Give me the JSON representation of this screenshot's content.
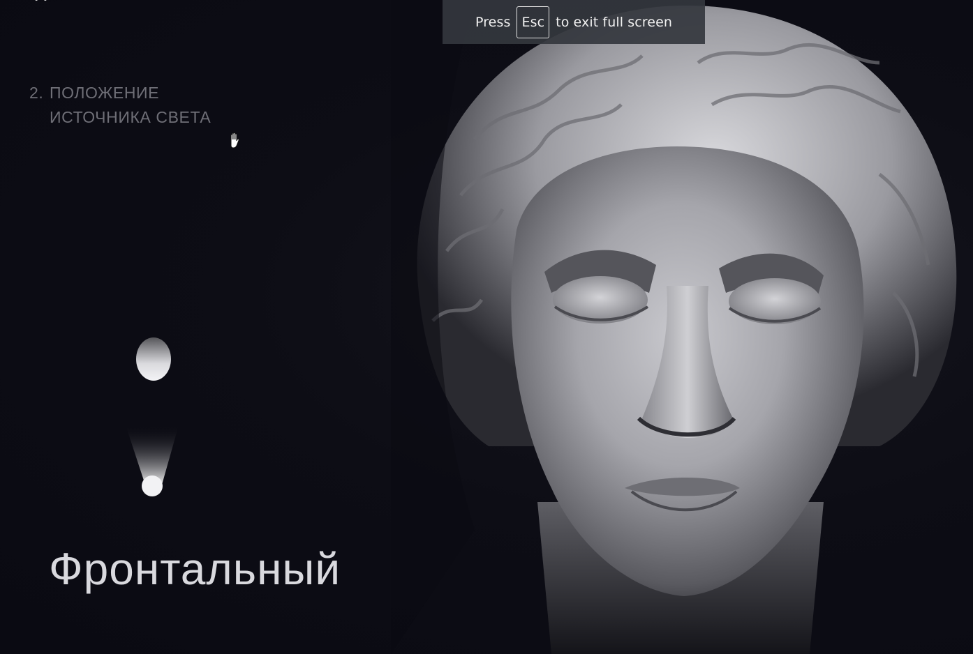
{
  "fullscreen_notice": {
    "prefix": "Press",
    "key": "Esc",
    "suffix": "to exit full screen"
  },
  "slide": {
    "section_number": "2.",
    "section_title_line1": "ПОЛОЖЕНИЕ",
    "section_title_line2": "ИСТОЧНИКА СВЕТА",
    "light_position_label": "Фронтальный",
    "subject_image": "plaster-head-sculpture",
    "cursor": "grab-hand-cursor-icon"
  },
  "colors": {
    "background": "#0b0b12",
    "heading": "#6f6f77",
    "caption": "#d9d9de",
    "toast": "#34373e"
  }
}
